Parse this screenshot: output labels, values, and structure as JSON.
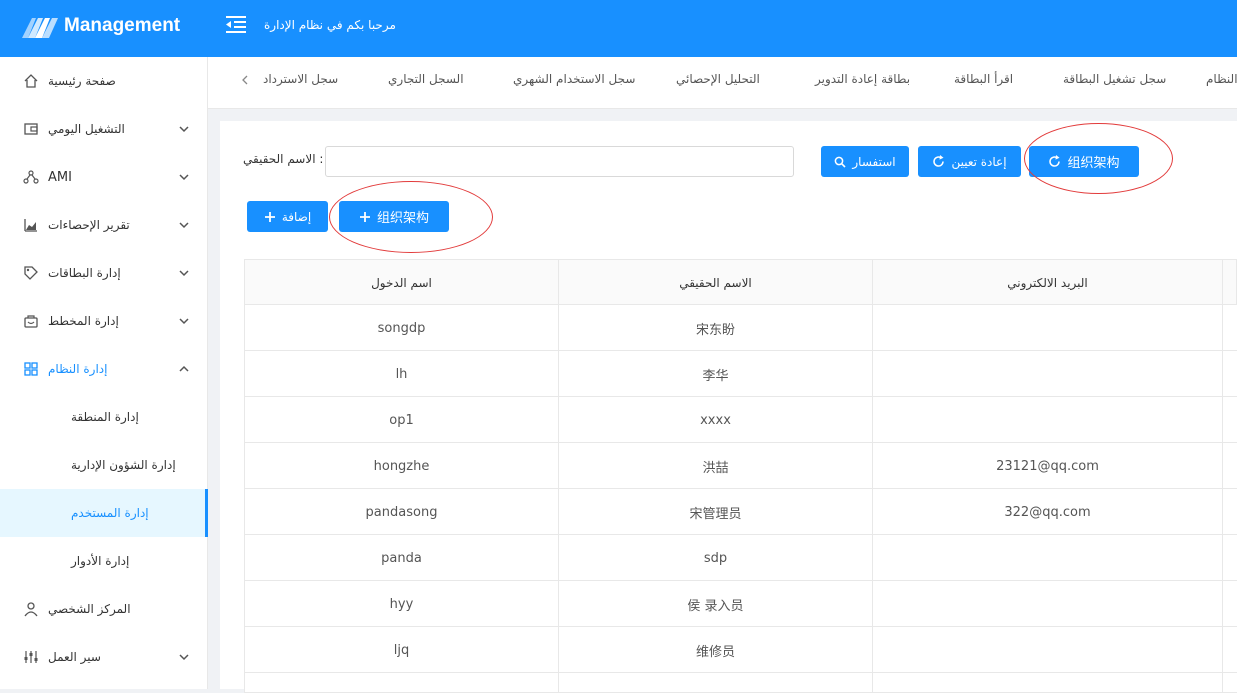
{
  "app": {
    "title": "Management",
    "welcome": "مرحبا بكم في نظام الإدارة"
  },
  "sidebar": {
    "items": [
      {
        "label": "صفحة رئيسية",
        "icon": "home-icon"
      },
      {
        "label": "التشغيل اليومي",
        "icon": "wallet-icon"
      },
      {
        "label": "AMI",
        "icon": "cluster-icon"
      },
      {
        "label": "تقرير الإحصاءات",
        "icon": "area-chart-icon"
      },
      {
        "label": "إدارة البطاقات",
        "icon": "tag-icon"
      },
      {
        "label": "إدارة المخطط",
        "icon": "shop-icon"
      },
      {
        "label": "إدارة النظام",
        "icon": "appstore-icon"
      },
      {
        "label": "المركز الشخصي",
        "icon": "user-icon"
      },
      {
        "label": "سير العمل",
        "icon": "sliders-icon"
      }
    ],
    "subitems": [
      {
        "label": "إدارة المنطقة"
      },
      {
        "label": "إدارة الشؤون الإدارية"
      },
      {
        "label": "إدارة المستخدم"
      },
      {
        "label": "إدارة الأدوار"
      }
    ]
  },
  "tabs": [
    "سجل الاسترداد",
    "السجل التجاري",
    "سجل الاستخدام الشهري",
    "التحليل الإحصائي",
    "بطاقة إعادة التدوير",
    "اقرأ البطاقة",
    "سجل تشغيل البطاقة",
    "النظام"
  ],
  "search": {
    "label": "الاسم الحقيقي :",
    "value": ""
  },
  "buttons": {
    "query": "استفسار",
    "reset": "إعادة تعيين",
    "org_top": "组织架构",
    "add": "إضافة",
    "org_bottom": "组织架构"
  },
  "table": {
    "headers": [
      "اسم الدخول",
      "الاسم الحقيقي",
      "البريد الالكتروني"
    ],
    "rows": [
      [
        "songdp",
        "宋东盼",
        ""
      ],
      [
        "lh",
        "李华",
        ""
      ],
      [
        "op1",
        "xxxx",
        ""
      ],
      [
        "hongzhe",
        "洪喆",
        "23121@qq.com"
      ],
      [
        "pandasong",
        "宋管理员",
        "322@qq.com"
      ],
      [
        "panda",
        "sdp",
        ""
      ],
      [
        "hyy",
        "侯 录入员",
        ""
      ],
      [
        "ljq",
        "维修员",
        ""
      ]
    ]
  },
  "colors": {
    "primary": "#1890ff",
    "annotation": "#e23b3b",
    "background": "#f0f2f5"
  }
}
